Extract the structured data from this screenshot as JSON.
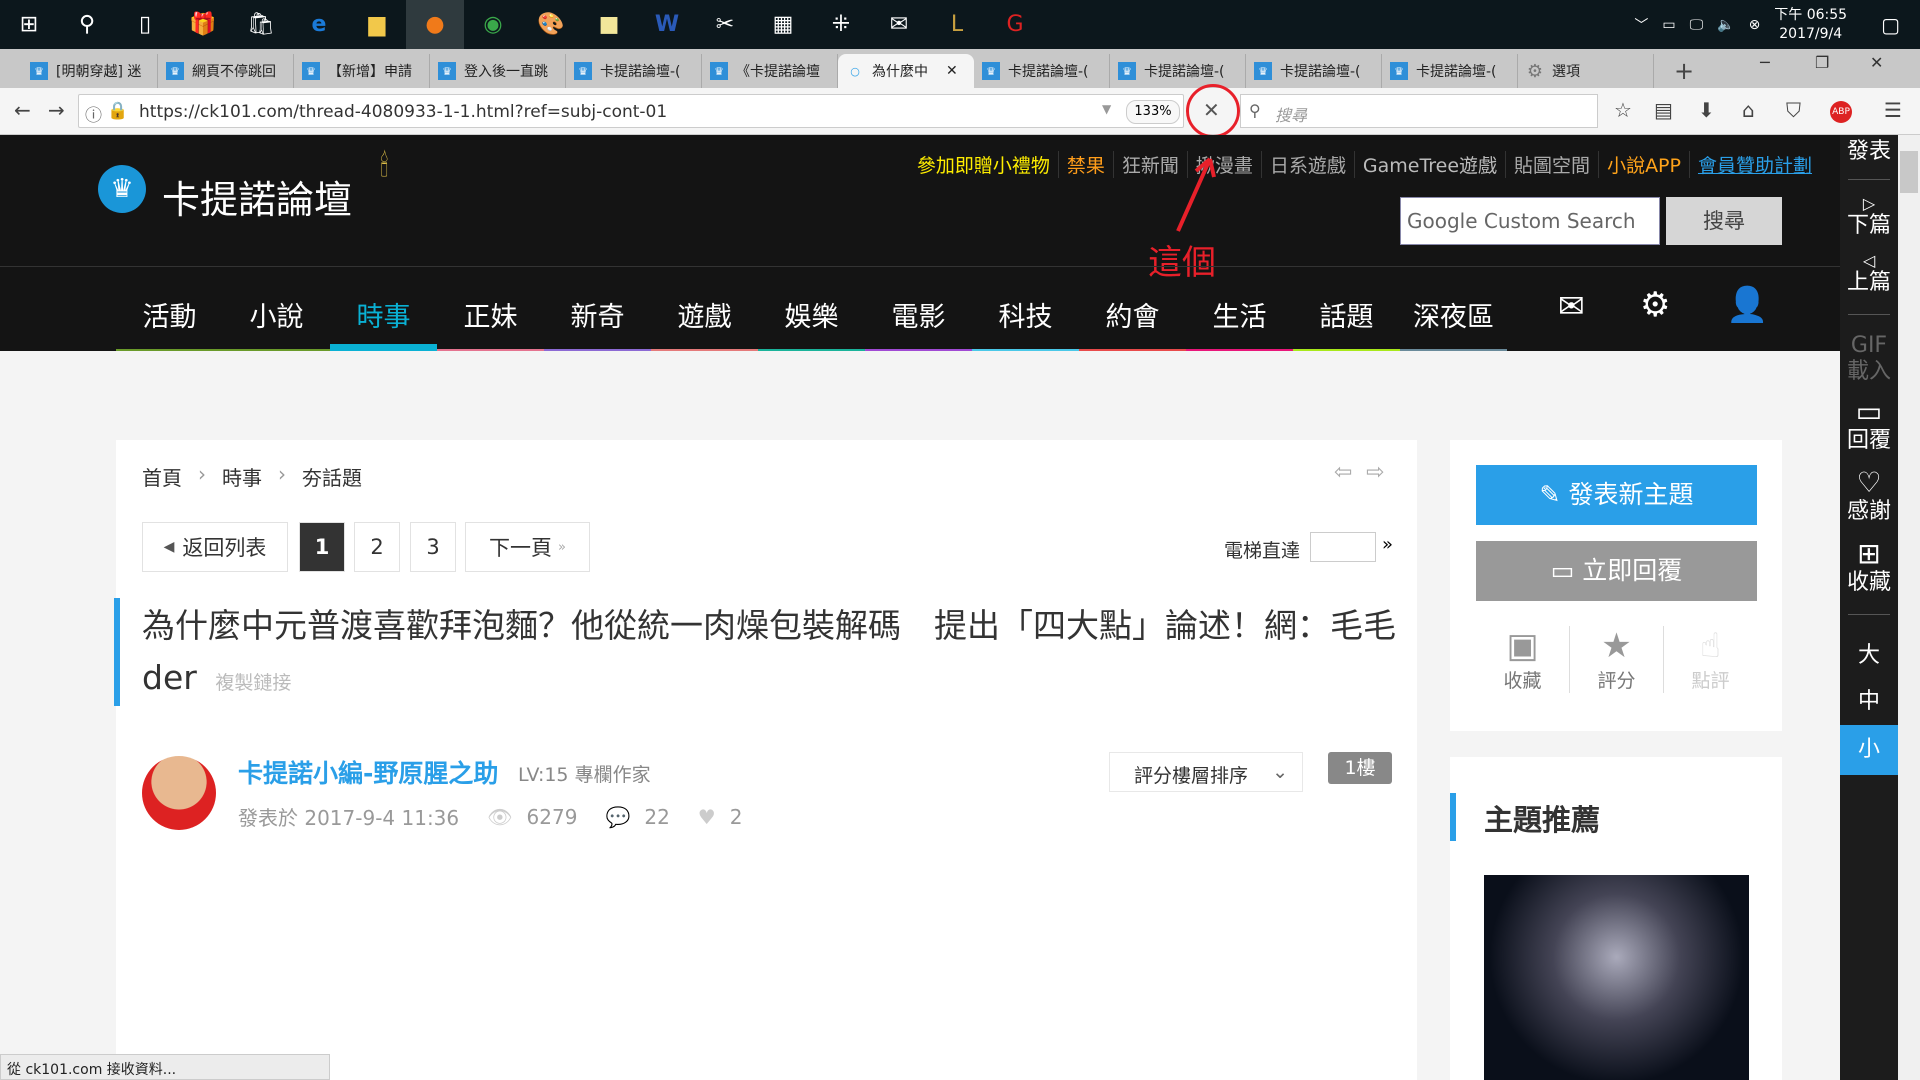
{
  "taskbar": {
    "icons": [
      "windows-start",
      "search",
      "task-view",
      "gift",
      "store",
      "edge",
      "file-explorer",
      "firefox",
      "chrome",
      "paint",
      "sticky-notes",
      "word",
      "snipping-tool",
      "calculator",
      "dots-app",
      "mail",
      "league-of-legends",
      "garena"
    ],
    "time": "下午 06:55",
    "date": "2017/9/4"
  },
  "browser": {
    "tabs": [
      "[明朝穿越] 迷",
      "網頁不停跳回",
      "【新增】申請",
      "登入後一直跳",
      "卡提諾論壇-(",
      "《卡提諾論壇",
      "為什麼中",
      "卡提諾論壇-(",
      "卡提諾論壇-(",
      "卡提諾論壇-(",
      "卡提諾論壇-(",
      "選項"
    ],
    "active_tab": 6,
    "url": "https://ck101.com/thread-4080933-1-1.html?ref=subj-cont-01",
    "zoom": "133%",
    "search_placeholder": "搜尋",
    "status": "從 ck101.com 接收資料..."
  },
  "annotation": {
    "text": "這個",
    "color": "#e8202a"
  },
  "site": {
    "logo": "卡提諾論壇",
    "top_links": [
      {
        "label": "參加即贈小禮物",
        "color": "#ffee00"
      },
      {
        "label": "禁果",
        "color": "#ff9d1a"
      },
      {
        "label": "狂新聞",
        "color": "#aaaaaa"
      },
      {
        "label": "揪漫畫",
        "color": "#aaaaaa"
      },
      {
        "label": "日系遊戲",
        "color": "#aaaaaa"
      },
      {
        "label": "GameTree遊戲",
        "color": "#bbbbbb"
      },
      {
        "label": "貼圖空間",
        "color": "#aaaaaa"
      },
      {
        "label": "小說APP",
        "color": "#ffa31a"
      },
      {
        "label": "會員贊助計劃",
        "color": "#2a9fe8"
      }
    ],
    "search_placeholder": "Google  Custom Search",
    "search_button": "搜尋",
    "nav": [
      {
        "label": "活動",
        "color": "#6a9a2a"
      },
      {
        "label": "小說",
        "color": "#6a9a2a"
      },
      {
        "label": "時事",
        "color": "#0ab1d4"
      },
      {
        "label": "正妹",
        "color": "#e4738f"
      },
      {
        "label": "新奇",
        "color": "#8c6ad4"
      },
      {
        "label": "遊戲",
        "color": "#e47a7a"
      },
      {
        "label": "娛樂",
        "color": "#1ab39a"
      },
      {
        "label": "電影",
        "color": "#a04ad4"
      },
      {
        "label": "科技",
        "color": "#4ac8e8"
      },
      {
        "label": "約會",
        "color": "#e84a4a"
      },
      {
        "label": "生活",
        "color": "#e8167a"
      },
      {
        "label": "話題",
        "color": "#a8e81a"
      },
      {
        "label": "深夜區",
        "color": "#6a8a9a"
      }
    ],
    "active_nav": 2
  },
  "thread": {
    "breadcrumb": [
      "首頁",
      "時事",
      "夯話題"
    ],
    "back": "返回列表",
    "pages": [
      "1",
      "2",
      "3"
    ],
    "current_page": "1",
    "next": "下一頁",
    "jump_label": "電梯直達",
    "title": "為什麼中元普渡喜歡拜泡麵？他從統一肉燥包裝解碼　提出「四大點」論述！網：毛毛der",
    "copy_link": "複製鏈接",
    "author": "卡提諾小編-野原腥之助",
    "level": "LV:15 專欄作家",
    "posted": "發表於 2017-9-4 11:36",
    "views": "6279",
    "replies": "22",
    "likes": "2",
    "sort": "評分樓層排序",
    "floor": "1樓"
  },
  "sidebar": {
    "new_topic": "發表新主題",
    "reply": "立即回覆",
    "actions": [
      "收藏",
      "評分",
      "點評"
    ],
    "recommend_title": "主題推薦"
  },
  "rail": {
    "items": [
      "發表",
      "下篇",
      "上篇",
      "GIF載入",
      "回覆",
      "感謝",
      "收藏"
    ],
    "sizes": [
      "大",
      "中",
      "小"
    ],
    "active_size": "小"
  },
  "colors": {
    "accent": "#2a9fe8",
    "header": "#141414"
  }
}
